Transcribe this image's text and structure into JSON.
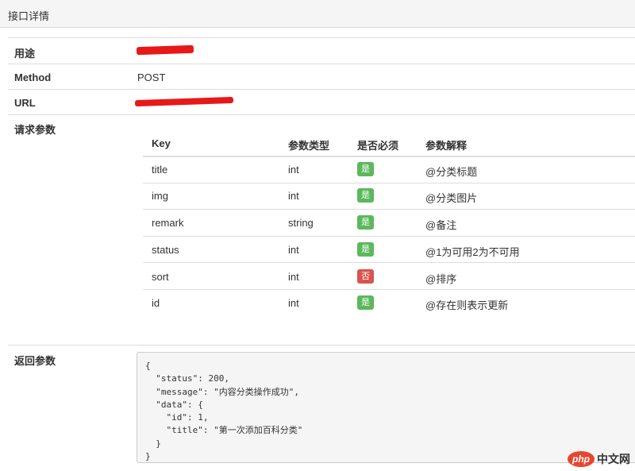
{
  "panel": {
    "title": "接口详情"
  },
  "info": {
    "usage_label": "用途",
    "method_label": "Method",
    "method_value": "POST",
    "url_label": "URL",
    "request_label": "请求参数",
    "response_label": "返回参数"
  },
  "params": {
    "headers": [
      "Key",
      "参数类型",
      "是否必须",
      "参数解释"
    ],
    "rows": [
      {
        "key": "title",
        "type": "int",
        "required": "是",
        "required_flag": true,
        "desc": "@分类标题"
      },
      {
        "key": "img",
        "type": "int",
        "required": "是",
        "required_flag": true,
        "desc": "@分类图片"
      },
      {
        "key": "remark",
        "type": "string",
        "required": "是",
        "required_flag": true,
        "desc": "@备注"
      },
      {
        "key": "status",
        "type": "int",
        "required": "是",
        "required_flag": true,
        "desc": "@1为可用2为不可用"
      },
      {
        "key": "sort",
        "type": "int",
        "required": "否",
        "required_flag": false,
        "desc": "@排序"
      },
      {
        "key": "id",
        "type": "int",
        "required": "是",
        "required_flag": true,
        "desc": "@存在则表示更新"
      }
    ]
  },
  "response_code": "{\n  \"status\": 200,\n  \"message\": \"内容分类操作成功\",\n  \"data\": {\n    \"id\": 1,\n    \"title\": \"第一次添加百科分类\"\n  }\n}",
  "watermark": {
    "logo": "php",
    "text": "中文网"
  },
  "colors": {
    "yes": "#5cb85c",
    "no": "#d9534f",
    "redaction": "#e81818"
  }
}
